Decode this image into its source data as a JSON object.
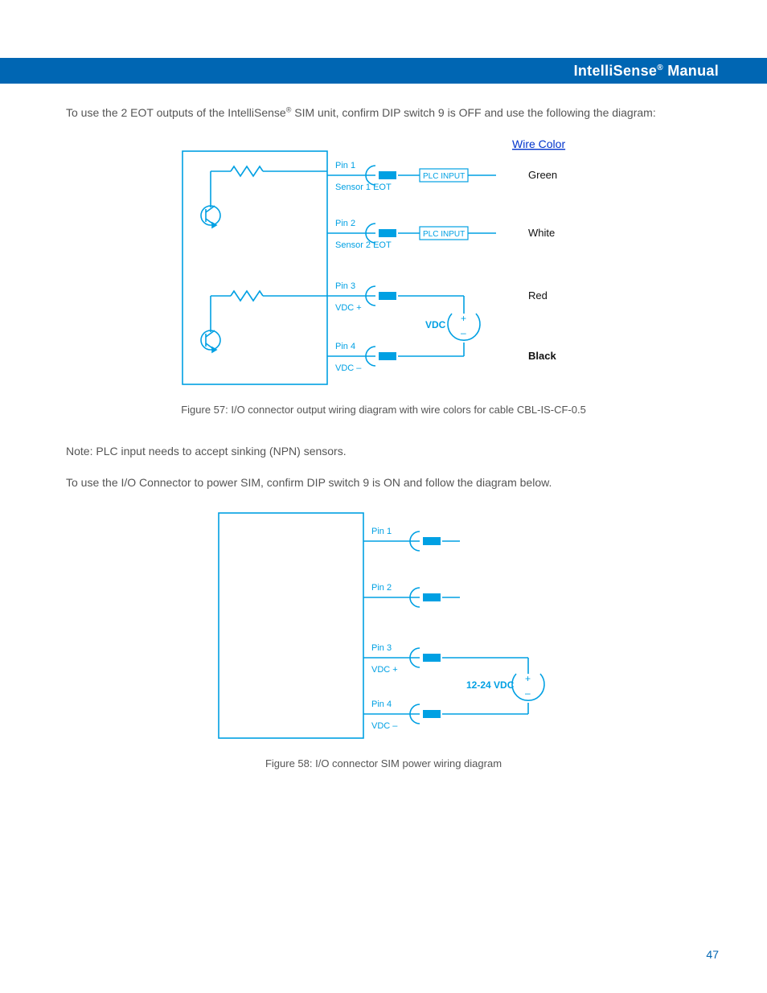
{
  "header": {
    "title_a": "IntelliSense",
    "title_b": " Manual",
    "reg": "®"
  },
  "p1": {
    "a": "To use the 2 EOT outputs of the IntelliSense",
    "b": " SIM unit, confirm DIP switch 9 is OFF and use the following the diagram:",
    "reg": "®"
  },
  "fig57": {
    "wire_color_heading": "Wire Color",
    "caption": "Figure 57: I/O connector output wiring diagram with wire colors for cable CBL-IS-CF-0.5",
    "plc": "PLC INPUT",
    "vdc": "VDC",
    "pins": [
      {
        "pin": "Pin 1",
        "sub": "Sensor 1 EOT",
        "color": "Green"
      },
      {
        "pin": "Pin 2",
        "sub": "Sensor 2 EOT",
        "color": "White"
      },
      {
        "pin": "Pin 3",
        "sub": "VDC +",
        "color": "Red"
      },
      {
        "pin": "Pin 4",
        "sub": "VDC –",
        "color": "Black"
      }
    ]
  },
  "note": "Note: PLC input needs to accept sinking (NPN) sensors.",
  "p2": "To use the I/O Connector to power SIM, confirm DIP switch 9 is ON and follow the diagram below.",
  "fig58": {
    "caption": "Figure 58: I/O connector SIM power wiring diagram",
    "vdc": "12-24 VDC",
    "pins": [
      {
        "pin": "Pin 1",
        "sub": ""
      },
      {
        "pin": "Pin 2",
        "sub": ""
      },
      {
        "pin": "Pin 3",
        "sub": "VDC +"
      },
      {
        "pin": "Pin 4",
        "sub": "VDC –"
      }
    ]
  },
  "pagenum": "47",
  "colors": {
    "brand": "#0066b3",
    "stroke": "#00a0e3",
    "black": "#111"
  }
}
